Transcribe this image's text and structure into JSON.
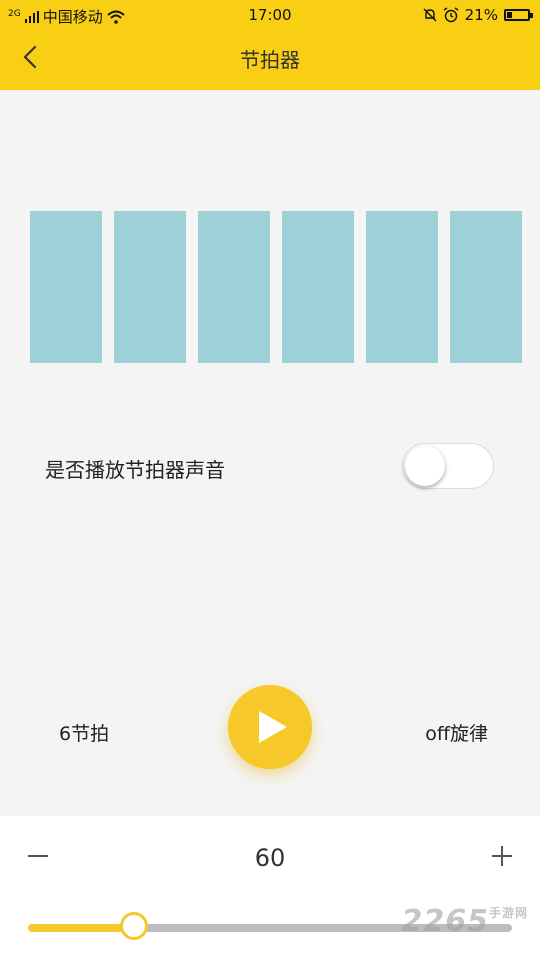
{
  "status_bar": {
    "network_label": "2G",
    "carrier": "中国移动",
    "time": "17:00",
    "battery_percent": "21%",
    "battery_level": 0.21
  },
  "nav": {
    "title": "节拍器",
    "back_icon": "chevron-left-icon"
  },
  "beats": {
    "count": 6,
    "color": "#9dd3d8"
  },
  "sound_toggle": {
    "label": "是否播放节拍器声音",
    "on": false
  },
  "controls": {
    "beats_label": "6节拍",
    "play_icon": "play-icon",
    "melody_label": "off旋律"
  },
  "tempo": {
    "bpm": "60",
    "slider_fraction": 0.22,
    "minus_icon": "minus-icon",
    "plus_icon": "plus-icon"
  },
  "watermark": {
    "text": "2265",
    "sub": "手游网"
  },
  "colors": {
    "accent": "#f8cf12",
    "play_button": "#f6c829",
    "background": "#f4f4f4"
  }
}
